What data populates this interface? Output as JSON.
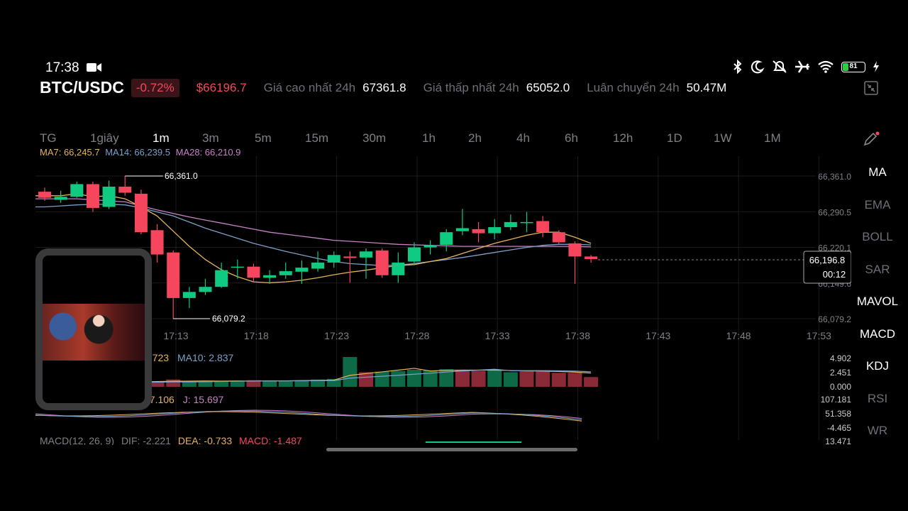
{
  "status_bar": {
    "time": "17:38",
    "battery": "81"
  },
  "ticker": {
    "pair": "BTC/USDC",
    "change": "-0.72%",
    "price": "$66196.7",
    "high_label": "Giá cao nhất 24h",
    "high_value": "67361.8",
    "low_label": "Giá thấp nhất 24h",
    "low_value": "65052.0",
    "turnover_label": "Luân chuyển 24h",
    "turnover_value": "50.47M"
  },
  "timeframes": [
    "TG",
    "1giây",
    "1m",
    "3m",
    "5m",
    "15m",
    "30m",
    "1h",
    "2h",
    "4h",
    "6h",
    "12h",
    "1D",
    "1W",
    "1M"
  ],
  "active_timeframe": "1m",
  "ma_legend": {
    "ma7": "MA7: 66,245.7",
    "ma14": "MA14: 66,239.5",
    "ma28": "MA28: 66,210.9"
  },
  "indicators": [
    "MA",
    "EMA",
    "BOLL",
    "SAR",
    "MAVOL",
    "MACD",
    "KDJ",
    "RSI",
    "WR"
  ],
  "active_indicators": [
    "MA",
    "MAVOL",
    "MACD",
    "KDJ"
  ],
  "price_axis": [
    "66,361.0",
    "66,290.5",
    "66,220.1",
    "66,149.6",
    "66,079.2"
  ],
  "last_price": {
    "price": "66,196.8",
    "countdown": "00:12"
  },
  "high_marker": "66,361.0",
  "low_marker": "66,079.2",
  "time_axis": [
    "17:13",
    "17:18",
    "17:23",
    "17:28",
    "17:33",
    "17:38",
    "17:43",
    "17:48",
    "17:53"
  ],
  "volume": {
    "legend_ma5": "2.723",
    "legend_ma10": "MA10: 2.837",
    "axis": [
      "4.902",
      "2.451",
      "0.000"
    ]
  },
  "kdj": {
    "legend_d": "57.106",
    "legend_j": "J: 15.697",
    "axis": [
      "107.181",
      "51.358",
      "-4.465"
    ]
  },
  "macd": {
    "legend_params": "MACD(12, 26, 9)",
    "legend_dif": "DIF: -2.221",
    "legend_dea": "DEA: -0.733",
    "legend_macd": "MACD: -1.487",
    "axis_top": "13.471"
  },
  "colors": {
    "up": "#0ecb81",
    "down": "#f6465d",
    "ma7": "#e6b35a",
    "ma14": "#7aa0c8",
    "ma28": "#c880c8"
  },
  "chart_data": {
    "type": "candlestick",
    "y_range": [
      66079.2,
      66361.0
    ],
    "candles": [
      {
        "o": 66330,
        "c": 66318,
        "h": 66338,
        "l": 66312
      },
      {
        "o": 66314,
        "c": 66320,
        "h": 66332,
        "l": 66308
      },
      {
        "o": 66320,
        "c": 66345,
        "h": 66350,
        "l": 66318
      },
      {
        "o": 66345,
        "c": 66298,
        "h": 66350,
        "l": 66290
      },
      {
        "o": 66300,
        "c": 66340,
        "h": 66352,
        "l": 66296
      },
      {
        "o": 66340,
        "c": 66328,
        "h": 66361,
        "l": 66322
      },
      {
        "o": 66326,
        "c": 66250,
        "h": 66334,
        "l": 66246
      },
      {
        "o": 66254,
        "c": 66206,
        "h": 66266,
        "l": 66190
      },
      {
        "o": 66210,
        "c": 66120,
        "h": 66214,
        "l": 66079
      },
      {
        "o": 66120,
        "c": 66132,
        "h": 66142,
        "l": 66100
      },
      {
        "o": 66132,
        "c": 66142,
        "h": 66158,
        "l": 66126
      },
      {
        "o": 66142,
        "c": 66175,
        "h": 66190,
        "l": 66140
      },
      {
        "o": 66180,
        "c": 66182,
        "h": 66196,
        "l": 66158
      },
      {
        "o": 66182,
        "c": 66160,
        "h": 66188,
        "l": 66152
      },
      {
        "o": 66160,
        "c": 66165,
        "h": 66175,
        "l": 66148
      },
      {
        "o": 66165,
        "c": 66173,
        "h": 66190,
        "l": 66158
      },
      {
        "o": 66172,
        "c": 66180,
        "h": 66194,
        "l": 66148
      },
      {
        "o": 66178,
        "c": 66190,
        "h": 66212,
        "l": 66172
      },
      {
        "o": 66190,
        "c": 66205,
        "h": 66212,
        "l": 66180
      },
      {
        "o": 66202,
        "c": 66199,
        "h": 66212,
        "l": 66150
      },
      {
        "o": 66200,
        "c": 66212,
        "h": 66218,
        "l": 66158
      },
      {
        "o": 66214,
        "c": 66165,
        "h": 66218,
        "l": 66160
      },
      {
        "o": 66165,
        "c": 66190,
        "h": 66210,
        "l": 66150
      },
      {
        "o": 66192,
        "c": 66220,
        "h": 66230,
        "l": 66186
      },
      {
        "o": 66220,
        "c": 66224,
        "h": 66234,
        "l": 66206
      },
      {
        "o": 66225,
        "c": 66250,
        "h": 66256,
        "l": 66212
      },
      {
        "o": 66252,
        "c": 66258,
        "h": 66296,
        "l": 66244
      },
      {
        "o": 66256,
        "c": 66248,
        "h": 66270,
        "l": 66230
      },
      {
        "o": 66248,
        "c": 66260,
        "h": 66276,
        "l": 66236
      },
      {
        "o": 66260,
        "c": 66270,
        "h": 66285,
        "l": 66254
      },
      {
        "o": 66270,
        "c": 66270,
        "h": 66290,
        "l": 66250
      },
      {
        "o": 66272,
        "c": 66250,
        "h": 66282,
        "l": 66240
      },
      {
        "o": 66250,
        "c": 66230,
        "h": 66254,
        "l": 66226
      },
      {
        "o": 66228,
        "c": 66202,
        "h": 66232,
        "l": 66148
      },
      {
        "o": 66202,
        "c": 66197,
        "h": 66205,
        "l": 66190
      }
    ],
    "ma7": [
      66322,
      66322,
      66326,
      66320,
      66322,
      66316,
      66300,
      66282,
      66252,
      66222,
      66196,
      66176,
      66162,
      66152,
      66150,
      66152,
      66155,
      66160,
      66166,
      66171,
      66175,
      66180,
      66184,
      66186,
      66192,
      66198,
      66208,
      66218,
      66228,
      66236,
      66244,
      66250,
      66250,
      66240,
      66228
    ],
    "ma14": [
      66300,
      66302,
      66304,
      66305,
      66305,
      66304,
      66298,
      66290,
      66282,
      66270,
      66258,
      66248,
      66238,
      66228,
      66220,
      66212,
      66205,
      66198,
      66192,
      66188,
      66186,
      66184,
      66185,
      66188,
      66192,
      66196,
      66200,
      66205,
      66210,
      66215,
      66220,
      66224,
      66226,
      66226,
      66225
    ],
    "ma28": [
      66316,
      66316,
      66316,
      66314,
      66312,
      66310,
      66302,
      66294,
      66287,
      66280,
      66274,
      66268,
      66262,
      66256,
      66250,
      66246,
      66242,
      66238,
      66234,
      66232,
      66230,
      66228,
      66226,
      66225,
      66224,
      66223,
      66222,
      66222,
      66222,
      66222,
      66222,
      66222,
      66222,
      66222,
      66221
    ],
    "volume": [
      0.6,
      0.5,
      0.6,
      0.9,
      0.7,
      0.8,
      1.0,
      0.9,
      1.2,
      0.8,
      0.9,
      0.9,
      1.0,
      1.1,
      1.0,
      0.9,
      1.1,
      1.2,
      1.3,
      4.9,
      2.4,
      2.5,
      2.6,
      2.8,
      2.7,
      2.9,
      2.7,
      2.6,
      2.8,
      2.4,
      2.6,
      2.5,
      2.3,
      2.3,
      1.6
    ],
    "volume_up": [
      false,
      true,
      true,
      false,
      true,
      false,
      false,
      false,
      false,
      true,
      true,
      true,
      true,
      false,
      true,
      true,
      true,
      true,
      true,
      true,
      false,
      true,
      true,
      true,
      true,
      true,
      false,
      false,
      true,
      true,
      false,
      false,
      false,
      false,
      false
    ]
  }
}
